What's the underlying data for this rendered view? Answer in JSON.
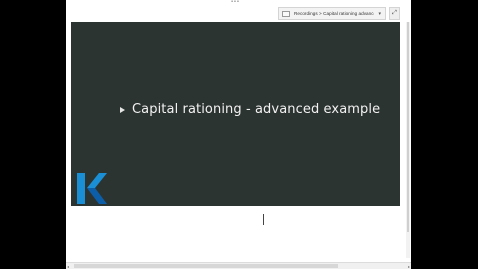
{
  "window": {
    "top_handle": "•••",
    "breadcrumb": {
      "icon": "folder-icon",
      "text": "Recordings > Capital rationing advanced",
      "dropdown": "▾"
    },
    "expand_button": {
      "icon": "expand-icon",
      "label": "⤢"
    }
  },
  "slide": {
    "bullet": "triangle-bullet-icon",
    "title": "Capital rationing - advanced example",
    "logo": {
      "name": "K logo",
      "color_primary": "#1a8fd6",
      "color_secondary": "#0d5ea8"
    },
    "background": "#2c3431"
  },
  "scrollbar_h": {
    "left_arrow": "◂",
    "right_arrow": "▸"
  }
}
